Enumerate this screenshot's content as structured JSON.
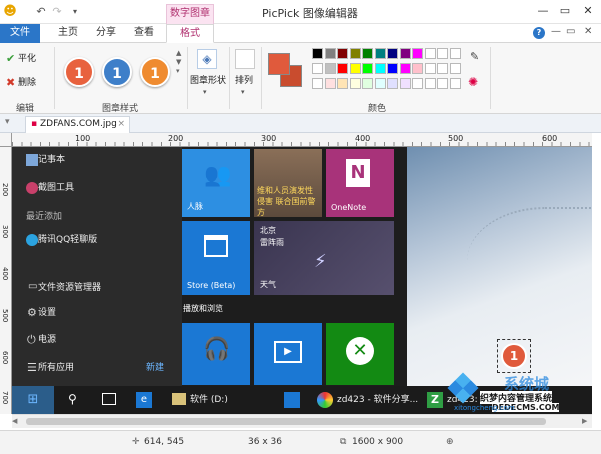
{
  "window": {
    "title": "PicPick 图像编辑器",
    "context_tab": "数字图章",
    "controls": [
      "—",
      "▭",
      "✕"
    ]
  },
  "ribbon_tabs": [
    "文件",
    "主页",
    "分享",
    "查看",
    "格式"
  ],
  "ribbon": {
    "edit_group": {
      "label": "编辑",
      "flatten": "平化",
      "delete": "删除"
    },
    "style_group": {
      "label": "图章样式",
      "stamps": [
        {
          "text": "1",
          "color": "#e8623e"
        },
        {
          "text": "1",
          "color": "#3e7fc9"
        },
        {
          "text": "1",
          "color": "#ef8b30"
        }
      ]
    },
    "shape_button": "图章形状",
    "arrange_button": "排列",
    "color_group": {
      "label": "颜色",
      "primary": "#e05a3c",
      "secondary": "#c94c2e",
      "row1": [
        "#000000",
        "#808080",
        "#800000",
        "#808000",
        "#008000",
        "#008080",
        "#000080",
        "#800080",
        "#ff00ff",
        "#ffffff",
        "#ffffff",
        "#ffffff"
      ],
      "row2": [
        "#ffffff",
        "#c0c0c0",
        "#ff0000",
        "#ffff00",
        "#00ff00",
        "#00ffff",
        "#0000ff",
        "#ff00ff",
        "#ffc0cb",
        "#ffffff",
        "#ffffff",
        "#ffffff"
      ],
      "row3": [
        "#ffffff",
        "#ffe0e0",
        "#ffe4b5",
        "#ffffe0",
        "#e0ffe0",
        "#e0ffff",
        "#e0e0ff",
        "#f0e0ff",
        "#ffffff",
        "#ffffff",
        "#ffffff",
        "#ffffff"
      ]
    }
  },
  "file_tab": {
    "name": "ZDFANS.COM.jpg",
    "close": "×"
  },
  "ruler": {
    "h_ticks": [
      "100",
      "200",
      "300",
      "400",
      "500",
      "600"
    ],
    "v_ticks": [
      "200",
      "300",
      "400",
      "500",
      "600",
      "700",
      "800"
    ]
  },
  "startmenu": {
    "items": [
      {
        "label": "记事本"
      },
      {
        "label": "截图工具"
      }
    ],
    "recent_header": "最近添加",
    "recent": [
      {
        "label": "腾讯QQ轻聊版"
      }
    ],
    "bottom": [
      {
        "label": "文件资源管理器"
      },
      {
        "label": "设置"
      },
      {
        "label": "电源"
      },
      {
        "label": "所有应用"
      }
    ],
    "new_badge": "新建",
    "tiles": {
      "people": "人脉",
      "news": "维和人员演发性 侵害 联合国前警方",
      "onenote": "OneNote",
      "store": "Store (Beta)",
      "weather_city": "北京",
      "weather_desc": "雷阵雨",
      "weather_label": "天气",
      "section": "播放和浏览"
    }
  },
  "taskbar": {
    "items": [
      "软件 (D:)",
      "zd423 - 软件分享...",
      "zd423: Group等..."
    ]
  },
  "canvas_stamp": {
    "text": "1",
    "color": "#e05a3c"
  },
  "watermark": {
    "brand": "系统城",
    "site": "xitongcheng.com",
    "overlay": "织梦内容管理系统",
    "domain": "DEDECMS.COM"
  },
  "statusbar": {
    "cursor": "614, 545",
    "selection": "36 x 36",
    "image_size": "1600 x 900"
  }
}
